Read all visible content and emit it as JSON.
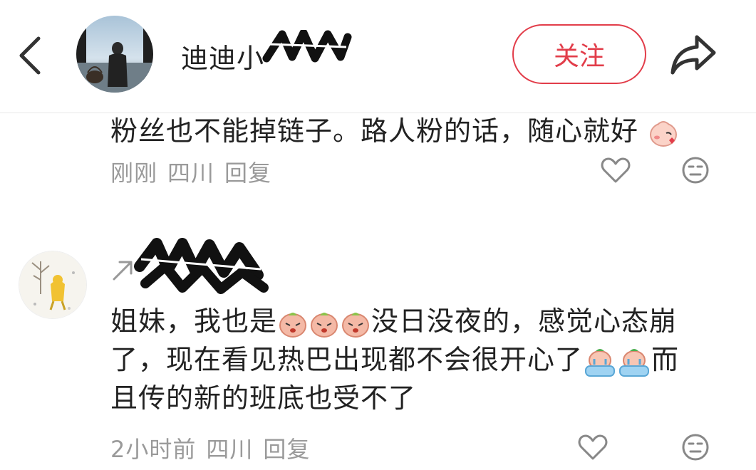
{
  "header": {
    "username": "迪迪小",
    "follow_label": "关注",
    "icons": {
      "back": "back-icon",
      "share": "share-icon"
    }
  },
  "comment1": {
    "text": "粉丝也不能掉链子。路人粉的话，随心就好",
    "time": "刚刚",
    "location": "四川",
    "reply": "回复"
  },
  "comment2": {
    "line1_a": "姐妹，我也是",
    "line1_b": "没日没夜的，感觉心态崩",
    "line2_a": "了，现在看见热巴出现都不会很开心了",
    "line2_b": "而",
    "line3": "且传的新的班底也受不了",
    "time": "2小时前",
    "location": "四川",
    "reply": "回复"
  },
  "colors": {
    "accent": "#e23d4a",
    "meta": "#9a9a9a",
    "text": "#222222"
  }
}
